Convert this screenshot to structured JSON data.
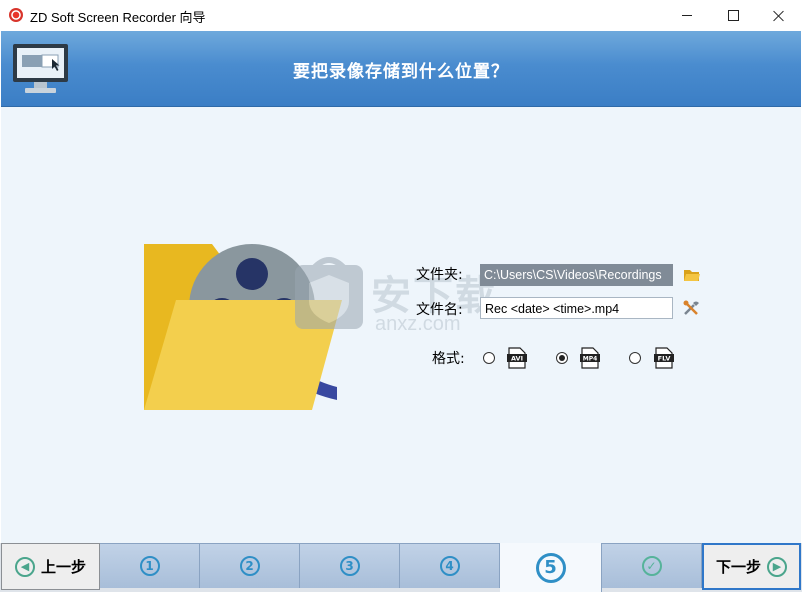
{
  "window": {
    "title": "ZD Soft Screen Recorder 向导",
    "app_icon": "record-icon",
    "controls": [
      "minimize-icon",
      "maximize-icon",
      "close-icon"
    ]
  },
  "banner": {
    "title": "要把录像存储到什么位置？",
    "icon": "monitor-icon"
  },
  "form": {
    "folder_label": "文件夹:",
    "folder_value": "C:\\Users\\CS\\Videos\\Recordings",
    "folder_button_icon": "folder-icon",
    "file_label": "文件名:",
    "file_value": "Rec <date> <time>.mp4",
    "file_button_icon": "tools-icon",
    "format_label": "格式:",
    "formats": [
      {
        "name": "AVI",
        "selected": false
      },
      {
        "name": "MP4",
        "selected": true
      },
      {
        "name": "FLV",
        "selected": false
      }
    ]
  },
  "watermark": {
    "text": "安下载",
    "sub": "anxz.com"
  },
  "footer": {
    "prev_label": "上一步",
    "next_label": "下一步",
    "steps": [
      "1",
      "2",
      "3",
      "4",
      "5",
      "✓"
    ],
    "active_step": 5
  },
  "colors": {
    "banner": "#4a8ccf",
    "content_bg": "#eef5fb",
    "step_accent": "#2f8fc6",
    "done_accent": "#56b39a"
  }
}
